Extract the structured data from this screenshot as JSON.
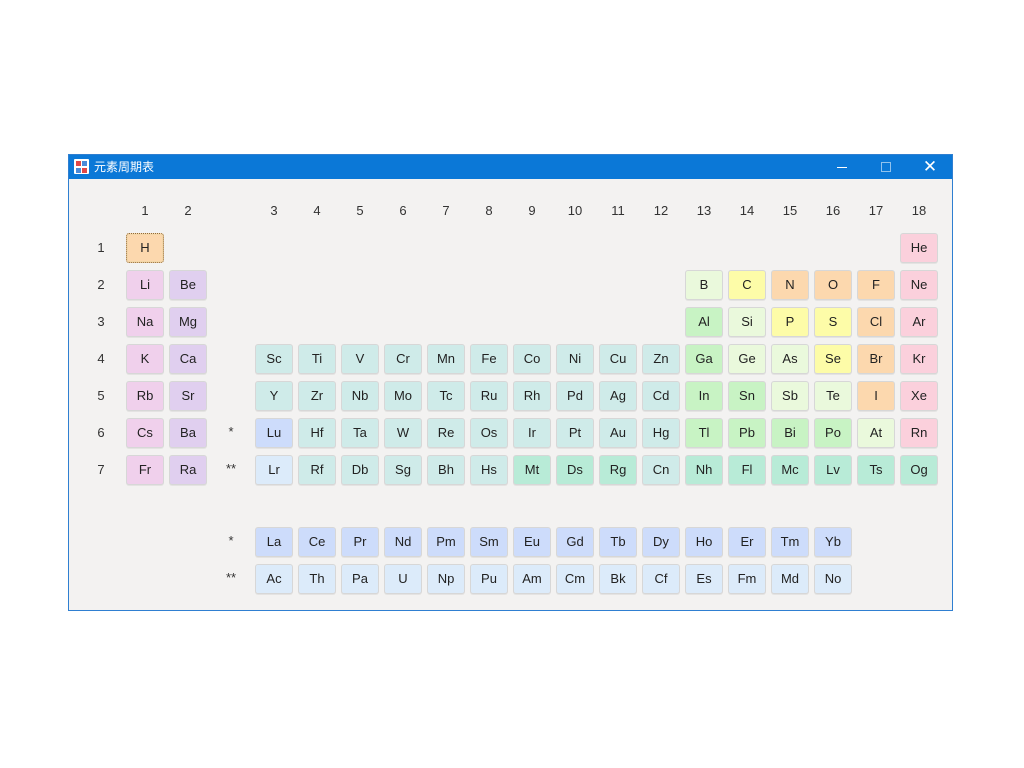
{
  "window": {
    "title": "元素周期表",
    "icon": "periodic-table-icon",
    "buttons": {
      "minimize": "minimize-icon",
      "maximize": "maximize-icon",
      "close": "close-icon"
    }
  },
  "groups": [
    "1",
    "2",
    "3",
    "4",
    "5",
    "6",
    "7",
    "8",
    "9",
    "10",
    "11",
    "12",
    "13",
    "14",
    "15",
    "16",
    "17",
    "18"
  ],
  "periods": [
    "1",
    "2",
    "3",
    "4",
    "5",
    "6",
    "7"
  ],
  "markers": {
    "lanthanide": "*",
    "actinide": "**"
  },
  "colors": {
    "nonmetal": "#fcd8ae",
    "alkali": "#f0d0ec",
    "alkaline": "#e0cfef",
    "transition": "#cfebe9",
    "lanthanide": "#cddcfb",
    "actinide": "#dcebfa",
    "post": "#c8f3c4",
    "metalloid": "#eaf9dc",
    "halogen": "#fcd8ae",
    "noble": "#fbd0dc",
    "unknown": "#b8ebd7",
    "chalcogen": "#fdfca8"
  },
  "elements": [
    {
      "s": "H",
      "p": 1,
      "g": 1,
      "c": "nonmetal",
      "sel": true
    },
    {
      "s": "He",
      "p": 1,
      "g": 18,
      "c": "noble"
    },
    {
      "s": "Li",
      "p": 2,
      "g": 1,
      "c": "alkali"
    },
    {
      "s": "Be",
      "p": 2,
      "g": 2,
      "c": "alkaline"
    },
    {
      "s": "B",
      "p": 2,
      "g": 13,
      "c": "metalloid"
    },
    {
      "s": "C",
      "p": 2,
      "g": 14,
      "c": "chalcogen"
    },
    {
      "s": "N",
      "p": 2,
      "g": 15,
      "c": "nonmetal"
    },
    {
      "s": "O",
      "p": 2,
      "g": 16,
      "c": "nonmetal"
    },
    {
      "s": "F",
      "p": 2,
      "g": 17,
      "c": "halogen"
    },
    {
      "s": "Ne",
      "p": 2,
      "g": 18,
      "c": "noble"
    },
    {
      "s": "Na",
      "p": 3,
      "g": 1,
      "c": "alkali"
    },
    {
      "s": "Mg",
      "p": 3,
      "g": 2,
      "c": "alkaline"
    },
    {
      "s": "Al",
      "p": 3,
      "g": 13,
      "c": "post"
    },
    {
      "s": "Si",
      "p": 3,
      "g": 14,
      "c": "metalloid"
    },
    {
      "s": "P",
      "p": 3,
      "g": 15,
      "c": "chalcogen"
    },
    {
      "s": "S",
      "p": 3,
      "g": 16,
      "c": "chalcogen"
    },
    {
      "s": "Cl",
      "p": 3,
      "g": 17,
      "c": "halogen"
    },
    {
      "s": "Ar",
      "p": 3,
      "g": 18,
      "c": "noble"
    },
    {
      "s": "K",
      "p": 4,
      "g": 1,
      "c": "alkali"
    },
    {
      "s": "Ca",
      "p": 4,
      "g": 2,
      "c": "alkaline"
    },
    {
      "s": "Sc",
      "p": 4,
      "g": 3,
      "c": "transition"
    },
    {
      "s": "Ti",
      "p": 4,
      "g": 4,
      "c": "transition"
    },
    {
      "s": "V",
      "p": 4,
      "g": 5,
      "c": "transition"
    },
    {
      "s": "Cr",
      "p": 4,
      "g": 6,
      "c": "transition"
    },
    {
      "s": "Mn",
      "p": 4,
      "g": 7,
      "c": "transition"
    },
    {
      "s": "Fe",
      "p": 4,
      "g": 8,
      "c": "transition"
    },
    {
      "s": "Co",
      "p": 4,
      "g": 9,
      "c": "transition"
    },
    {
      "s": "Ni",
      "p": 4,
      "g": 10,
      "c": "transition"
    },
    {
      "s": "Cu",
      "p": 4,
      "g": 11,
      "c": "transition"
    },
    {
      "s": "Zn",
      "p": 4,
      "g": 12,
      "c": "transition"
    },
    {
      "s": "Ga",
      "p": 4,
      "g": 13,
      "c": "post"
    },
    {
      "s": "Ge",
      "p": 4,
      "g": 14,
      "c": "metalloid"
    },
    {
      "s": "As",
      "p": 4,
      "g": 15,
      "c": "metalloid"
    },
    {
      "s": "Se",
      "p": 4,
      "g": 16,
      "c": "chalcogen"
    },
    {
      "s": "Br",
      "p": 4,
      "g": 17,
      "c": "halogen"
    },
    {
      "s": "Kr",
      "p": 4,
      "g": 18,
      "c": "noble"
    },
    {
      "s": "Rb",
      "p": 5,
      "g": 1,
      "c": "alkali"
    },
    {
      "s": "Sr",
      "p": 5,
      "g": 2,
      "c": "alkaline"
    },
    {
      "s": "Y",
      "p": 5,
      "g": 3,
      "c": "transition"
    },
    {
      "s": "Zr",
      "p": 5,
      "g": 4,
      "c": "transition"
    },
    {
      "s": "Nb",
      "p": 5,
      "g": 5,
      "c": "transition"
    },
    {
      "s": "Mo",
      "p": 5,
      "g": 6,
      "c": "transition"
    },
    {
      "s": "Tc",
      "p": 5,
      "g": 7,
      "c": "transition"
    },
    {
      "s": "Ru",
      "p": 5,
      "g": 8,
      "c": "transition"
    },
    {
      "s": "Rh",
      "p": 5,
      "g": 9,
      "c": "transition"
    },
    {
      "s": "Pd",
      "p": 5,
      "g": 10,
      "c": "transition"
    },
    {
      "s": "Ag",
      "p": 5,
      "g": 11,
      "c": "transition"
    },
    {
      "s": "Cd",
      "p": 5,
      "g": 12,
      "c": "transition"
    },
    {
      "s": "In",
      "p": 5,
      "g": 13,
      "c": "post"
    },
    {
      "s": "Sn",
      "p": 5,
      "g": 14,
      "c": "post"
    },
    {
      "s": "Sb",
      "p": 5,
      "g": 15,
      "c": "metalloid"
    },
    {
      "s": "Te",
      "p": 5,
      "g": 16,
      "c": "metalloid"
    },
    {
      "s": "I",
      "p": 5,
      "g": 17,
      "c": "halogen"
    },
    {
      "s": "Xe",
      "p": 5,
      "g": 18,
      "c": "noble"
    },
    {
      "s": "Cs",
      "p": 6,
      "g": 1,
      "c": "alkali"
    },
    {
      "s": "Ba",
      "p": 6,
      "g": 2,
      "c": "alkaline"
    },
    {
      "s": "Lu",
      "p": 6,
      "g": 3,
      "c": "lanthanide"
    },
    {
      "s": "Hf",
      "p": 6,
      "g": 4,
      "c": "transition"
    },
    {
      "s": "Ta",
      "p": 6,
      "g": 5,
      "c": "transition"
    },
    {
      "s": "W",
      "p": 6,
      "g": 6,
      "c": "transition"
    },
    {
      "s": "Re",
      "p": 6,
      "g": 7,
      "c": "transition"
    },
    {
      "s": "Os",
      "p": 6,
      "g": 8,
      "c": "transition"
    },
    {
      "s": "Ir",
      "p": 6,
      "g": 9,
      "c": "transition"
    },
    {
      "s": "Pt",
      "p": 6,
      "g": 10,
      "c": "transition"
    },
    {
      "s": "Au",
      "p": 6,
      "g": 11,
      "c": "transition"
    },
    {
      "s": "Hg",
      "p": 6,
      "g": 12,
      "c": "transition"
    },
    {
      "s": "Tl",
      "p": 6,
      "g": 13,
      "c": "post"
    },
    {
      "s": "Pb",
      "p": 6,
      "g": 14,
      "c": "post"
    },
    {
      "s": "Bi",
      "p": 6,
      "g": 15,
      "c": "post"
    },
    {
      "s": "Po",
      "p": 6,
      "g": 16,
      "c": "post"
    },
    {
      "s": "At",
      "p": 6,
      "g": 17,
      "c": "metalloid"
    },
    {
      "s": "Rn",
      "p": 6,
      "g": 18,
      "c": "noble"
    },
    {
      "s": "Fr",
      "p": 7,
      "g": 1,
      "c": "alkali"
    },
    {
      "s": "Ra",
      "p": 7,
      "g": 2,
      "c": "alkaline"
    },
    {
      "s": "Lr",
      "p": 7,
      "g": 3,
      "c": "actinide"
    },
    {
      "s": "Rf",
      "p": 7,
      "g": 4,
      "c": "transition"
    },
    {
      "s": "Db",
      "p": 7,
      "g": 5,
      "c": "transition"
    },
    {
      "s": "Sg",
      "p": 7,
      "g": 6,
      "c": "transition"
    },
    {
      "s": "Bh",
      "p": 7,
      "g": 7,
      "c": "transition"
    },
    {
      "s": "Hs",
      "p": 7,
      "g": 8,
      "c": "transition"
    },
    {
      "s": "Mt",
      "p": 7,
      "g": 9,
      "c": "unknown"
    },
    {
      "s": "Ds",
      "p": 7,
      "g": 10,
      "c": "unknown"
    },
    {
      "s": "Rg",
      "p": 7,
      "g": 11,
      "c": "unknown"
    },
    {
      "s": "Cn",
      "p": 7,
      "g": 12,
      "c": "transition"
    },
    {
      "s": "Nh",
      "p": 7,
      "g": 13,
      "c": "unknown"
    },
    {
      "s": "Fl",
      "p": 7,
      "g": 14,
      "c": "unknown"
    },
    {
      "s": "Mc",
      "p": 7,
      "g": 15,
      "c": "unknown"
    },
    {
      "s": "Lv",
      "p": 7,
      "g": 16,
      "c": "unknown"
    },
    {
      "s": "Ts",
      "p": 7,
      "g": 17,
      "c": "unknown"
    },
    {
      "s": "Og",
      "p": 7,
      "g": 18,
      "c": "unknown"
    }
  ],
  "lanthanides": {
    "label": "*",
    "c": "lanthanide",
    "items": [
      "La",
      "Ce",
      "Pr",
      "Nd",
      "Pm",
      "Sm",
      "Eu",
      "Gd",
      "Tb",
      "Dy",
      "Ho",
      "Er",
      "Tm",
      "Yb"
    ]
  },
  "actinides": {
    "label": "**",
    "c": "actinide",
    "items": [
      "Ac",
      "Th",
      "Pa",
      "U",
      "Np",
      "Pu",
      "Am",
      "Cm",
      "Bk",
      "Cf",
      "Es",
      "Fm",
      "Md",
      "No"
    ]
  }
}
